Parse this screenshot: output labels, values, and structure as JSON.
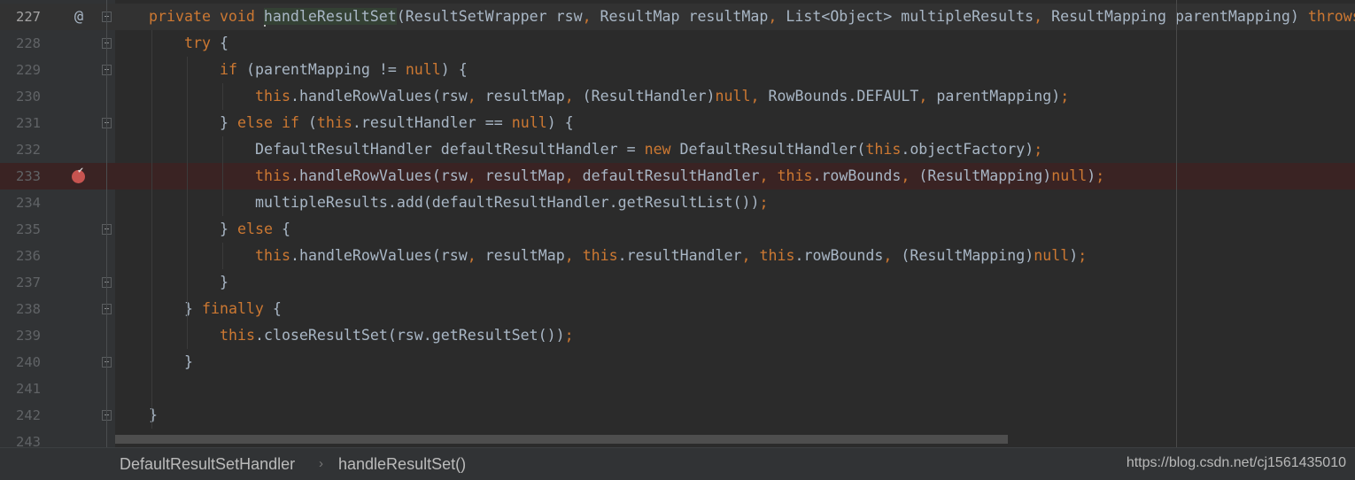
{
  "editor": {
    "colors": {
      "background": "#2b2b2b",
      "gutter": "#313335",
      "keyword": "#cc7832",
      "text": "#a9b7c6",
      "breakpoint": "#c75450",
      "breakpoint_line": "#3a2323",
      "current_line": "#323232"
    },
    "keywords": [
      "private",
      "void",
      "try",
      "if",
      "else",
      "this",
      "null",
      "new",
      "finally",
      "throws"
    ],
    "lines": [
      {
        "number": "227",
        "indent": 1,
        "code": "private void handleResultSet(ResultSetWrapper rsw, ResultMap resultMap, List<Object> multipleResults, ResultMapping parentMapping) throws",
        "gutter_icon": "at-sign-icon",
        "gutter_text": "@",
        "fold": "open",
        "current": true,
        "highlight": "handleResultSet"
      },
      {
        "number": "228",
        "indent": 2,
        "code": "try {",
        "fold": "open"
      },
      {
        "number": "229",
        "indent": 3,
        "code": "if (parentMapping != null) {",
        "fold": "open"
      },
      {
        "number": "230",
        "indent": 4,
        "code": "this.handleRowValues(rsw, resultMap, (ResultHandler)null, RowBounds.DEFAULT, parentMapping);"
      },
      {
        "number": "231",
        "indent": 3,
        "code": "} else if (this.resultHandler == null) {",
        "fold": "close"
      },
      {
        "number": "232",
        "indent": 4,
        "code": "DefaultResultHandler defaultResultHandler = new DefaultResultHandler(this.objectFactory);"
      },
      {
        "number": "233",
        "indent": 4,
        "code": "this.handleRowValues(rsw, resultMap, defaultResultHandler, this.rowBounds, (ResultMapping)null);",
        "gutter_icon": "breakpoint-verified-icon",
        "breakpoint": true
      },
      {
        "number": "234",
        "indent": 4,
        "code": "multipleResults.add(defaultResultHandler.getResultList());"
      },
      {
        "number": "235",
        "indent": 3,
        "code": "} else {",
        "fold": "open"
      },
      {
        "number": "236",
        "indent": 4,
        "code": "this.handleRowValues(rsw, resultMap, this.resultHandler, this.rowBounds, (ResultMapping)null);"
      },
      {
        "number": "237",
        "indent": 3,
        "code": "}",
        "fold": "close"
      },
      {
        "number": "238",
        "indent": 2,
        "code": "} finally {",
        "fold": "open"
      },
      {
        "number": "239",
        "indent": 3,
        "code": "this.closeResultSet(rsw.getResultSet());"
      },
      {
        "number": "240",
        "indent": 2,
        "code": "}",
        "fold": "close"
      },
      {
        "number": "241",
        "indent": 0,
        "code": ""
      },
      {
        "number": "242",
        "indent": 1,
        "code": "}",
        "fold": "close"
      },
      {
        "number": "243",
        "indent": 0,
        "code": ""
      }
    ]
  },
  "breadcrumb": {
    "class": "DefaultResultSetHandler",
    "separator": "›",
    "method": "handleResultSet()"
  },
  "watermark": "https://blog.csdn.net/cj1561435010"
}
